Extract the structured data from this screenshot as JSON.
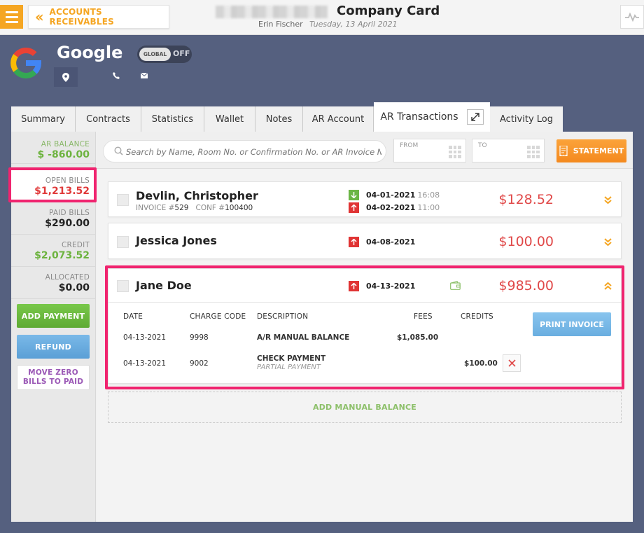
{
  "topbar": {
    "back_label": "ACCOUNTS RECEIVABLES",
    "title": "Company Card",
    "user": "Erin Fischer",
    "date": "Tuesday, 13 April 2021"
  },
  "customer": {
    "name": "Google",
    "global_label": "GLOBAL",
    "global_state": "OFF"
  },
  "tabs": [
    {
      "label": "Summary"
    },
    {
      "label": "Contracts"
    },
    {
      "label": "Statistics"
    },
    {
      "label": "Wallet"
    },
    {
      "label": "Notes"
    },
    {
      "label": "AR Account"
    },
    {
      "label": "AR Transactions"
    },
    {
      "label": "Activity Log"
    }
  ],
  "sidebar": {
    "stats": [
      {
        "label": "AR BALANCE",
        "value": "$ -860.00",
        "color": "#6db33f"
      },
      {
        "label": "OPEN BILLS",
        "value": "$1,213.52",
        "color": "#e03a3a"
      },
      {
        "label": "PAID BILLS",
        "value": "$290.00",
        "color": "#222222"
      },
      {
        "label": "CREDIT",
        "value": "$2,073.52",
        "color": "#6db33f"
      },
      {
        "label": "ALLOCATED",
        "value": "$0.00",
        "color": "#222222"
      }
    ],
    "add_payment": "ADD PAYMENT",
    "refund": "REFUND",
    "move_zero_1": "MOVE ZERO",
    "move_zero_2": "BILLS TO PAID"
  },
  "filters": {
    "search_placeholder": "Search by Name, Room No. or Confirmation No. or AR Invoice No.",
    "from_label": "FROM",
    "to_label": "TO",
    "statement": "STATEMENT"
  },
  "bills": [
    {
      "name": "Devlin, Christopher",
      "invoice_label": "INVOICE #",
      "invoice": "529",
      "conf_label": "CONF #",
      "conf": "100400",
      "date1": "04-01-2021",
      "time1": "16:08",
      "date2": "04-02-2021",
      "time2": "11:00",
      "amount": "$128.52"
    },
    {
      "name": "Jessica Jones",
      "date": "04-08-2021",
      "amount": "$100.00"
    },
    {
      "name": "Jane Doe",
      "date": "04-13-2021",
      "amount": "$985.00",
      "headers": {
        "date": "DATE",
        "charge_code": "CHARGE CODE",
        "description": "DESCRIPTION",
        "fees": "FEES",
        "credits": "CREDITS"
      },
      "rows": [
        {
          "date": "04-13-2021",
          "code": "9998",
          "desc": "A/R MANUAL BALANCE",
          "sub": "",
          "fees": "$1,085.00",
          "credits": ""
        },
        {
          "date": "04-13-2021",
          "code": "9002",
          "desc": "CHECK PAYMENT",
          "sub": "PARTIAL PAYMENT",
          "fees": "",
          "credits": "$100.00"
        }
      ],
      "print_invoice": "PRINT INVOICE"
    }
  ],
  "add_manual_balance": "ADD MANUAL BALANCE",
  "colors": {
    "accent": "#f5a623",
    "highlight": "#f0246f",
    "red": "#e04848",
    "green": "#6db33f"
  }
}
